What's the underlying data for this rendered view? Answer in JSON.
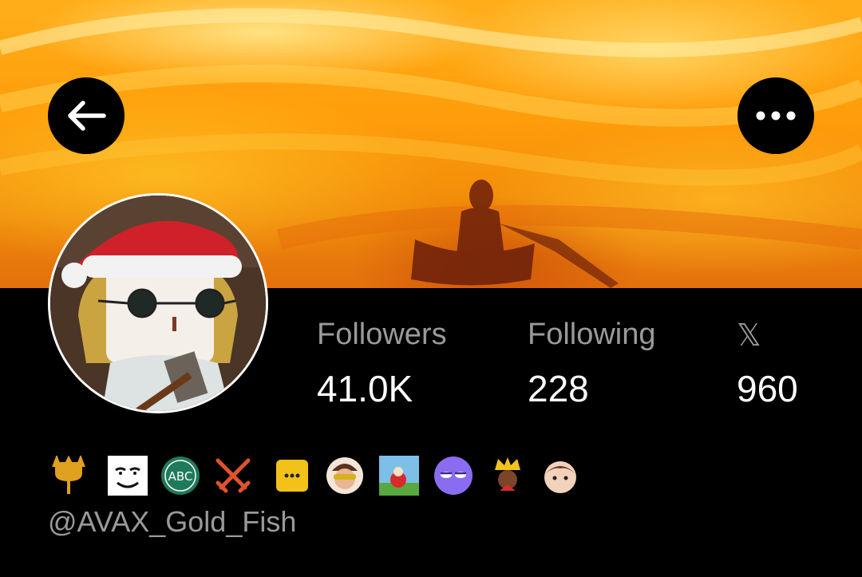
{
  "header": {
    "back_icon": "arrow-left-icon",
    "more_icon": "more-horizontal-icon"
  },
  "profile": {
    "handle": "@AVAX_Gold_Fish",
    "stats": [
      {
        "label": "Followers",
        "value": "41.0K"
      },
      {
        "label": "Following",
        "value": "228"
      },
      {
        "label": "𝕏",
        "value": "960"
      }
    ],
    "badges": [
      "trident-icon",
      "meme-face-icon",
      "abc-circle-icon",
      "crossed-swords-icon",
      "chat-bubble-icon",
      "sunglasses-avatar-icon",
      "santa-scene-icon",
      "purple-face-icon",
      "king-crown-icon",
      "cartoon-head-icon"
    ]
  },
  "colors": {
    "background": "#000000",
    "label_gray": "#9a9a9a",
    "banner_orange": "#ff9d0a"
  }
}
